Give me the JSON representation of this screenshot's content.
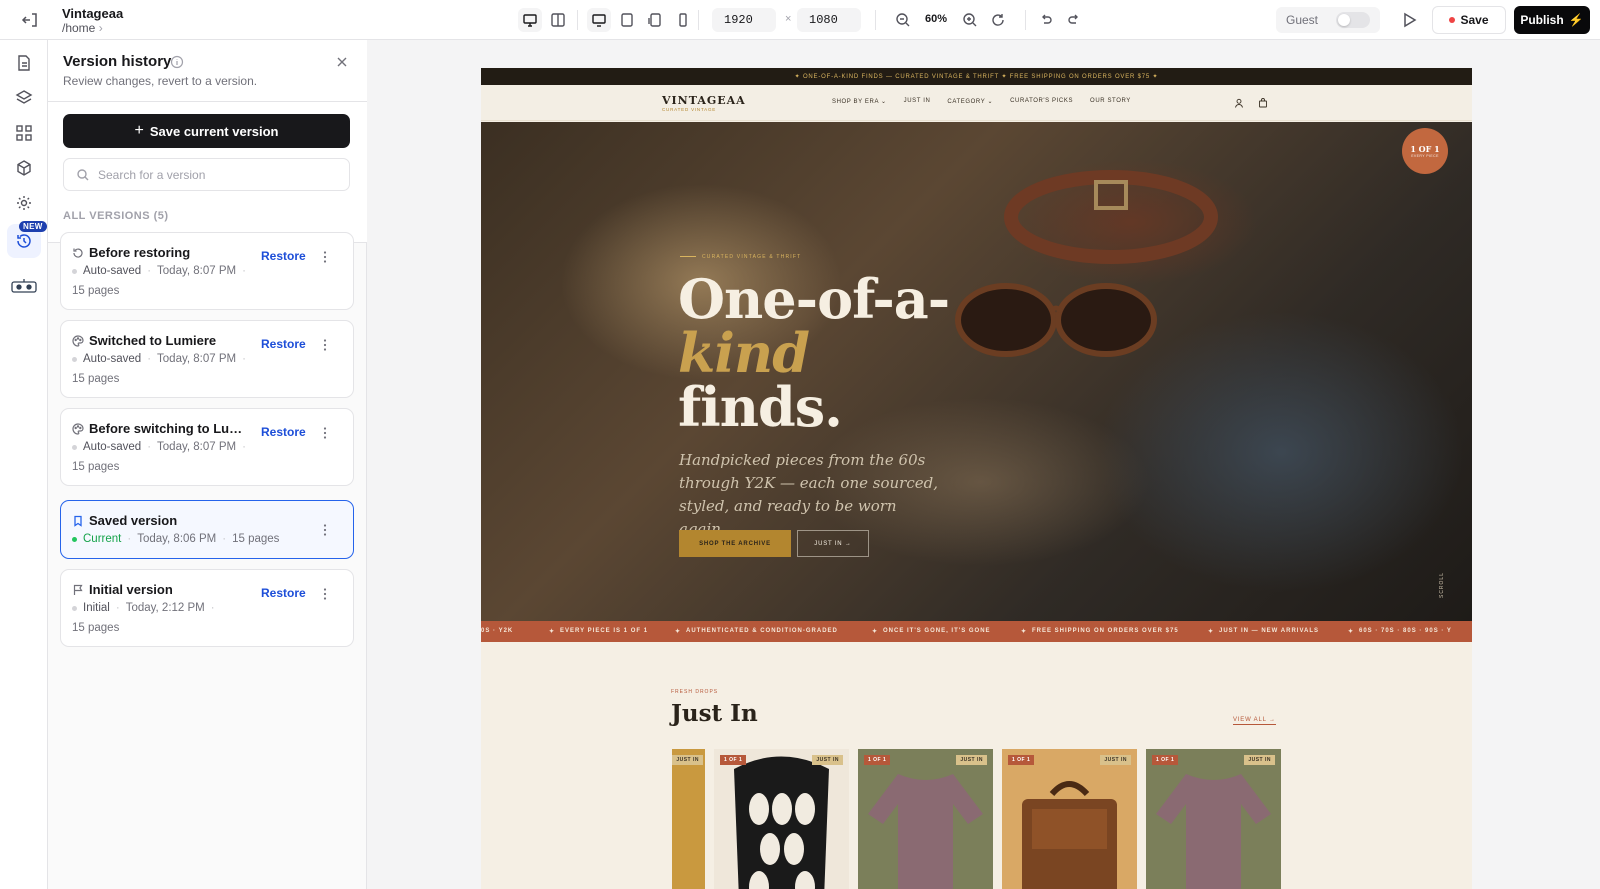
{
  "app": {
    "project_name": "Vintageaa",
    "path": "/home",
    "width_value": "1920",
    "height_value": "1080",
    "dim_separator": "×",
    "zoom": "60%",
    "guest_label": "Guest",
    "save_label": "Save",
    "publish_label": "Publish"
  },
  "rail": {
    "new_badge": "NEW"
  },
  "panel": {
    "title": "Version history",
    "subtitle": "Review changes, revert to a version.",
    "save_current_label": "Save current version",
    "search_placeholder": "Search for a version",
    "all_versions_label": "ALL VERSIONS (5)",
    "restore_label": "Restore",
    "versions": [
      {
        "name": "Before restoring",
        "status": "Auto-saved",
        "time": "Today, 8:07 PM",
        "pages": "15 pages",
        "icon": "restore-icon",
        "current": false
      },
      {
        "name": "Switched to Lumiere",
        "status": "Auto-saved",
        "time": "Today, 8:07 PM",
        "pages": "15 pages",
        "icon": "palette-icon",
        "current": false
      },
      {
        "name": "Before switching to Lumi…",
        "status": "Auto-saved",
        "time": "Today, 8:07 PM",
        "pages": "15 pages",
        "icon": "palette-icon",
        "current": false
      },
      {
        "name": "Saved version",
        "status": "Current",
        "time": "Today, 8:06 PM",
        "pages": "15 pages",
        "icon": "bookmark-icon",
        "current": true
      },
      {
        "name": "Initial version",
        "status": "Initial",
        "time": "Today, 2:12 PM",
        "pages": "15 pages",
        "icon": "flag-icon",
        "current": false
      }
    ]
  },
  "site": {
    "promo": "✦ ONE-OF-A-KIND FINDS — CURATED VINTAGE & THRIFT ✦ FREE SHIPPING ON ORDERS OVER $75 ✦",
    "brand": "VINTAGEAA",
    "brand_sub": "CURATED VINTAGE",
    "nav": [
      "SHOP BY ERA ⌄",
      "JUST IN",
      "CATEGORY ⌄",
      "CURATOR'S PICKS",
      "OUR STORY"
    ],
    "badge_title": "1 OF 1",
    "badge_sub": "EVERY PIECE",
    "hero_eyebrow": "CURATED VINTAGE & THRIFT",
    "hero_line1": "One-of-a-",
    "hero_line2": "kind",
    "hero_line3": "finds.",
    "hero_desc": "Handpicked pieces from the 60s through Y2K — each one sourced, styled, and ready to be worn again.",
    "cta_primary": "SHOP THE ARCHIVE",
    "cta_secondary": "JUST IN →",
    "scroll_label": "SCROLL",
    "ticker": [
      "0S · Y2K",
      "✦",
      "EVERY PIECE IS 1 OF 1",
      "✦",
      "AUTHENTICATED & CONDITION-GRADED",
      "✦",
      "ONCE IT'S GONE, IT'S GONE",
      "✦",
      "FREE SHIPPING ON ORDERS OVER $75",
      "✦",
      "JUST IN — NEW ARRIVALS",
      "✦",
      "60S · 70S · 80S · 90S · Y"
    ],
    "section_eyebrow": "FRESH DROPS",
    "section_title": "Just In",
    "view_all": "VIEW ALL →",
    "tag_1of1": "1 OF 1",
    "tag_justin": "JUST IN"
  }
}
